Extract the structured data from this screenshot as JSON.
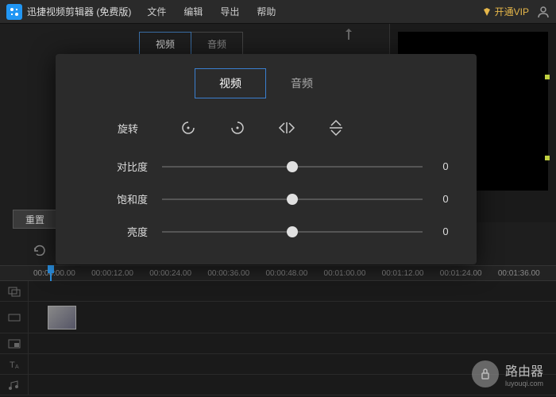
{
  "app": {
    "title": "迅捷视频剪辑器 (免费版)"
  },
  "menu": {
    "file": "文件",
    "edit": "编辑",
    "export": "导出",
    "help": "帮助"
  },
  "vip": {
    "label": "开通VIP"
  },
  "bg_tabs": {
    "video": "视频",
    "audio": "音频"
  },
  "reset_label": "重置",
  "timeline": {
    "marks": [
      "00:00:00.00",
      "00:00:12.00",
      "00:00:24.00",
      "00:00:36.00",
      "00:00:48.00",
      "00:01:00.00",
      "00:01:12.00",
      "00:01:24.00",
      "00:01:36.00"
    ]
  },
  "modal": {
    "tabs": {
      "video": "视频",
      "audio": "音频"
    },
    "rotate_label": "旋转",
    "sliders": {
      "contrast": {
        "label": "对比度",
        "value": "0"
      },
      "saturation": {
        "label": "饱和度",
        "value": "0"
      },
      "brightness": {
        "label": "亮度",
        "value": "0"
      }
    }
  },
  "watermark": {
    "title": "路由器",
    "sub": "luyouqi.com"
  }
}
